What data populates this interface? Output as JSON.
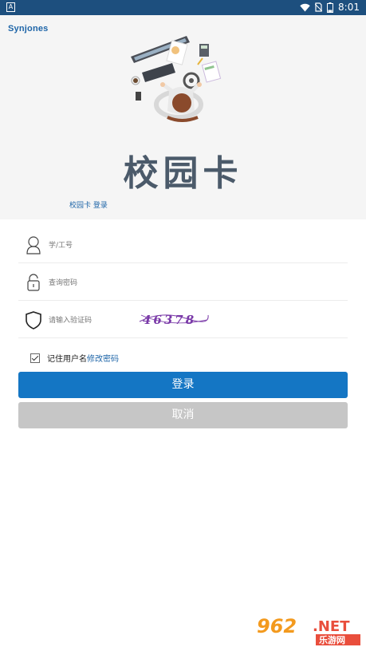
{
  "status_bar": {
    "app_badge": "A",
    "time": "8:01",
    "battery_level": "8"
  },
  "brand": {
    "name": "Synjones"
  },
  "hero": {
    "title": "校园卡",
    "subtitle": "校园卡 登录"
  },
  "form": {
    "id_placeholder": "学/工号",
    "password_placeholder": "查询密码",
    "captcha_placeholder": "请输入验证码",
    "captcha_text": "46378"
  },
  "remember": {
    "label": "记住用户名",
    "change_password": "修改密码"
  },
  "buttons": {
    "login": "登录",
    "cancel": "取消"
  },
  "watermark": {
    "brand": "962",
    "suffix": ".NET",
    "cn": "乐游网"
  },
  "colors": {
    "status_bar": "#1d4f7e",
    "primary": "#1476c4",
    "disabled": "#c6c6c6",
    "link": "#1e65a8"
  }
}
